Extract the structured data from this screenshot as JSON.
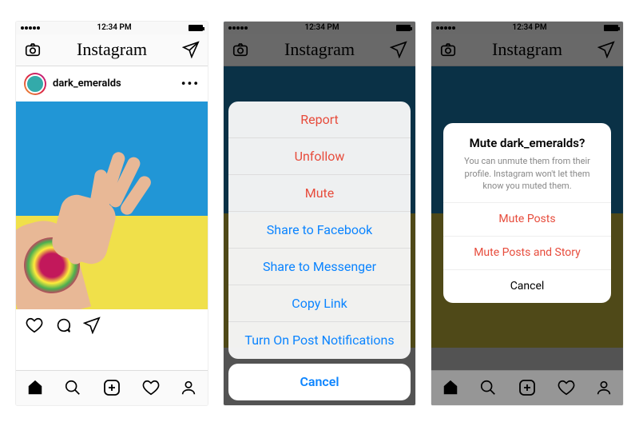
{
  "status": {
    "time": "12:34 PM"
  },
  "app": {
    "title": "Instagram"
  },
  "post": {
    "username": "dark_emeralds"
  },
  "actionSheet": {
    "items": [
      {
        "label": "Report",
        "style": "red"
      },
      {
        "label": "Unfollow",
        "style": "red"
      },
      {
        "label": "Mute",
        "style": "red"
      },
      {
        "label": "Share to Facebook",
        "style": "blue"
      },
      {
        "label": "Share to Messenger",
        "style": "blue"
      },
      {
        "label": "Copy Link",
        "style": "blue"
      },
      {
        "label": "Turn On Post Notifications",
        "style": "blue"
      }
    ],
    "cancel": "Cancel"
  },
  "muteAlert": {
    "title": "Mute dark_emeralds?",
    "message": "You can unmute them from their profile. Instagram won't let them know you muted them.",
    "option1": "Mute Posts",
    "option2": "Mute Posts and Story",
    "cancel": "Cancel"
  }
}
